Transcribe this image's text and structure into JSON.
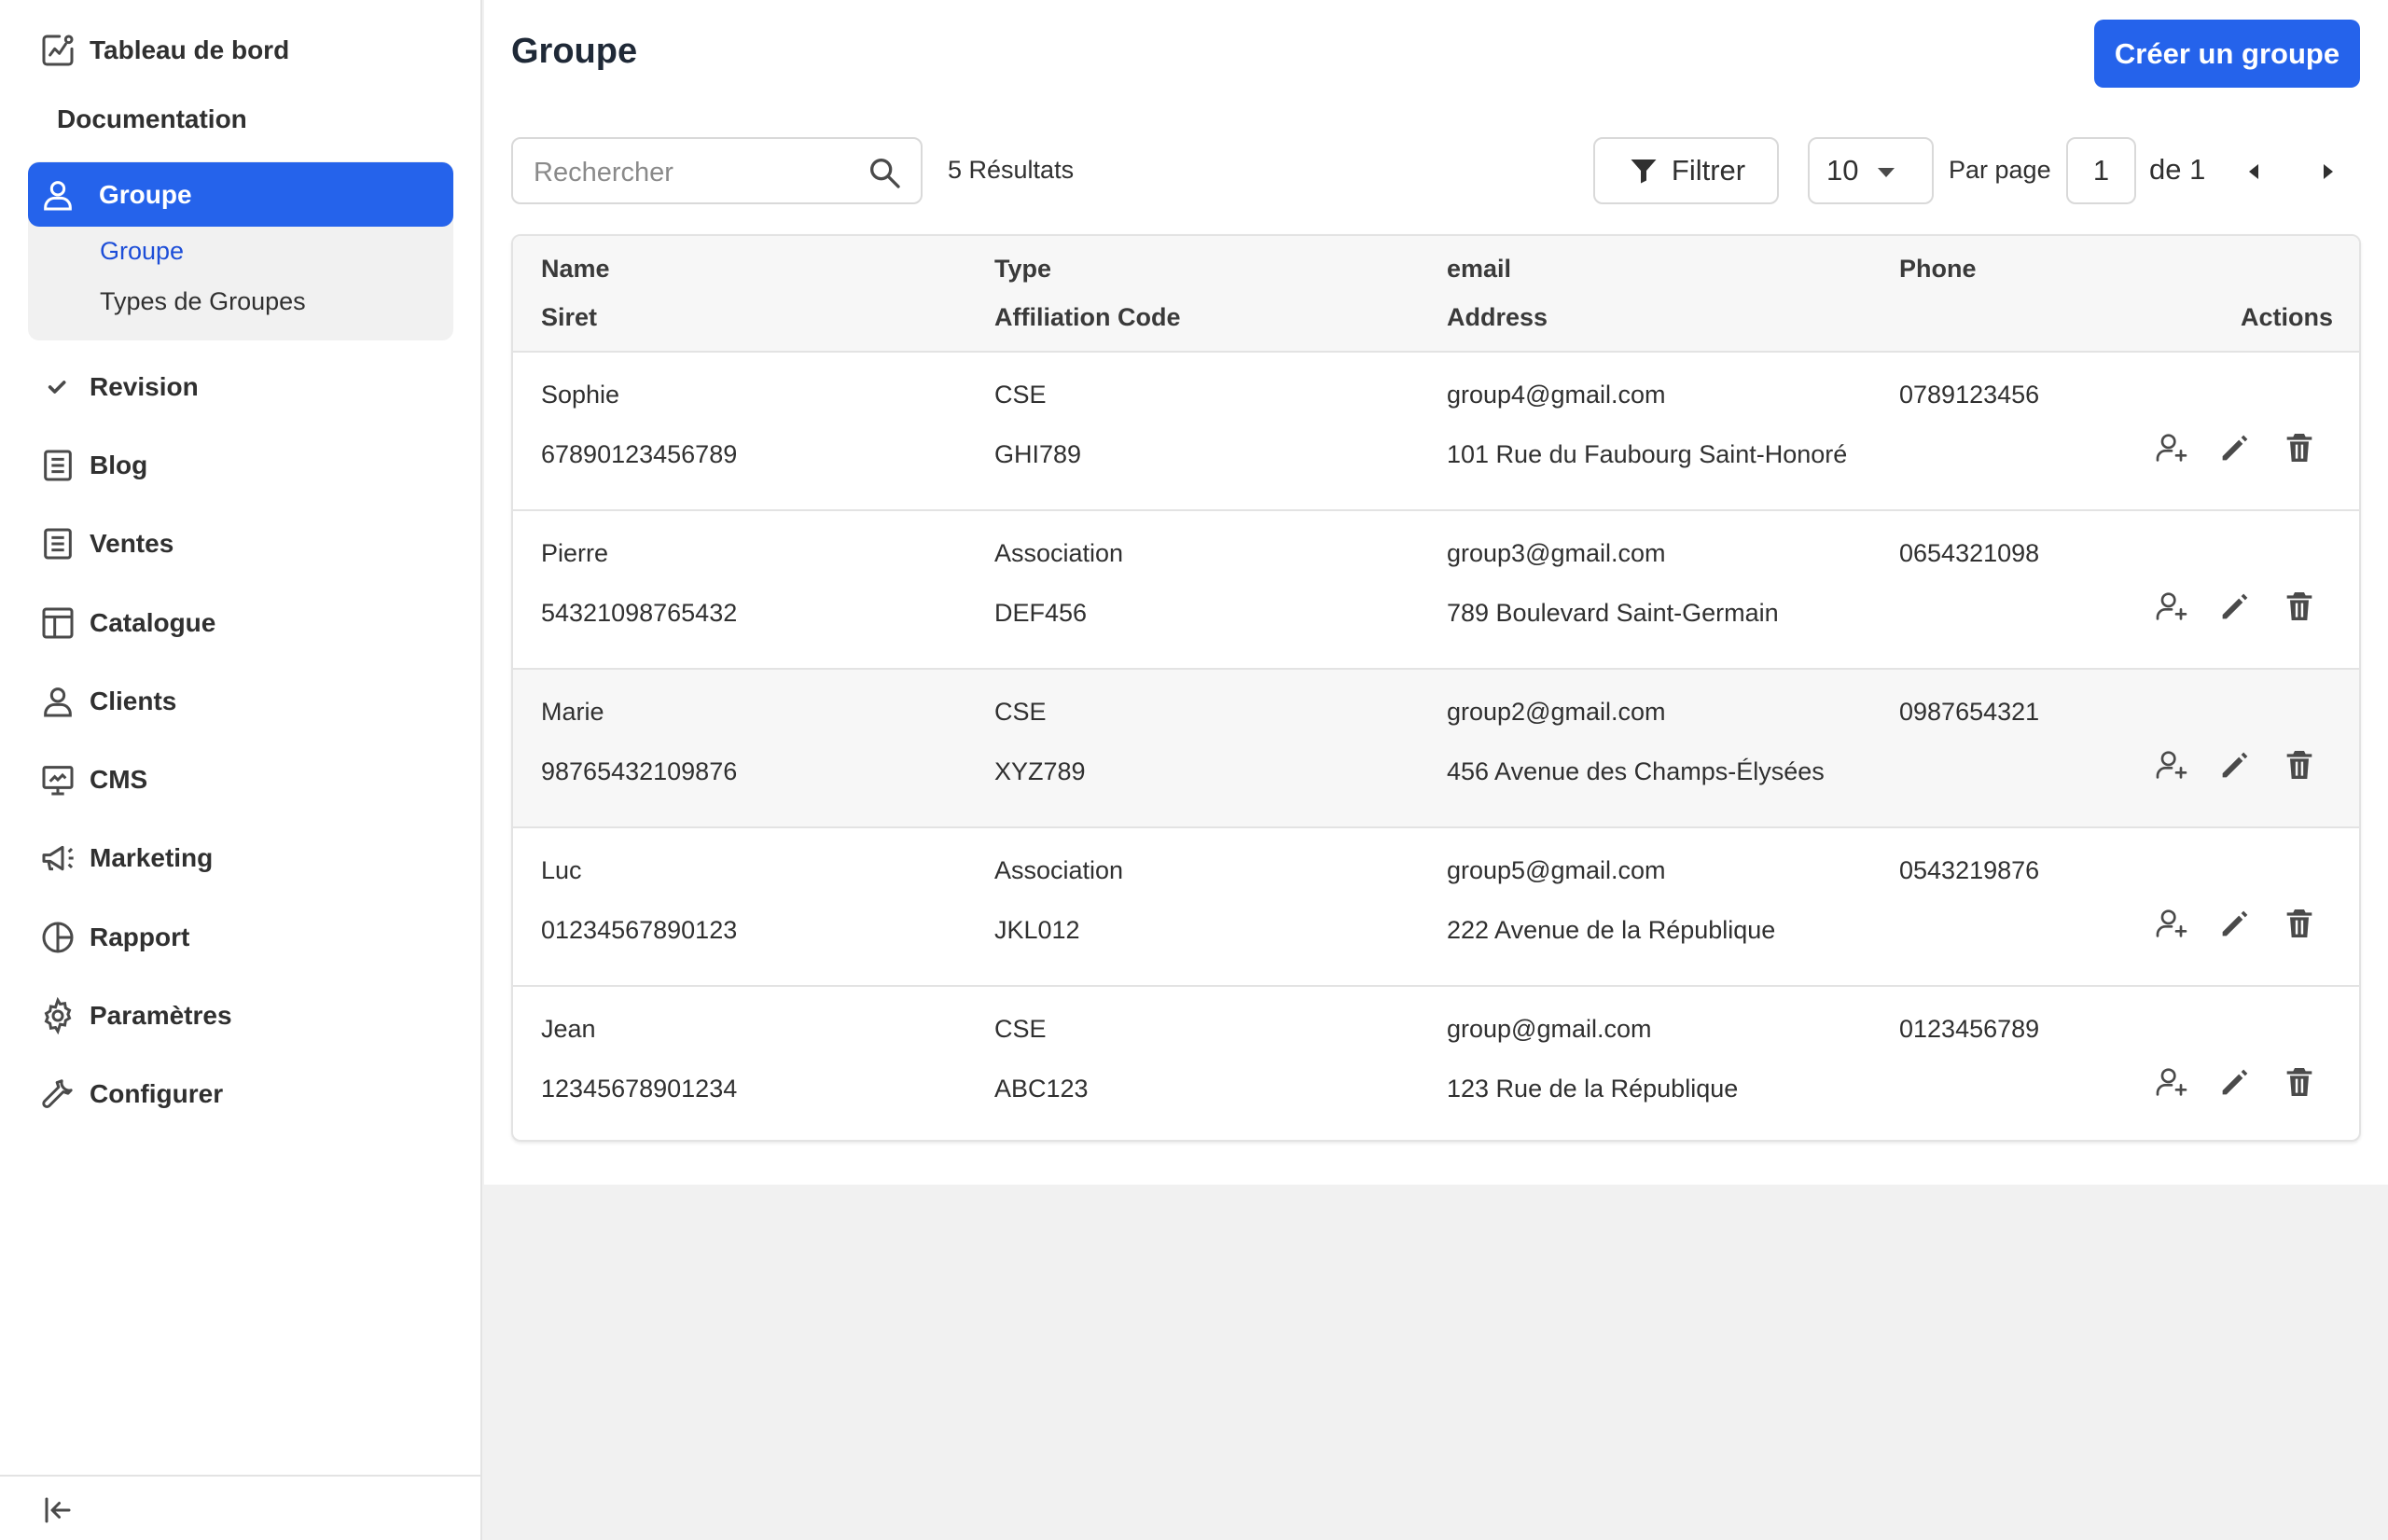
{
  "sidebar": {
    "dashboard": "Tableau de bord",
    "documentation": "Documentation",
    "active_section": "Groupe",
    "sub_items": [
      "Groupe",
      "Types de Groupes"
    ],
    "items": [
      {
        "label": "Revision",
        "icon": "check-icon"
      },
      {
        "label": "Blog",
        "icon": "document-icon"
      },
      {
        "label": "Ventes",
        "icon": "document-icon"
      },
      {
        "label": "Catalogue",
        "icon": "layout-icon"
      },
      {
        "label": "Clients",
        "icon": "user-icon"
      },
      {
        "label": "CMS",
        "icon": "monitor-icon"
      },
      {
        "label": "Marketing",
        "icon": "megaphone-icon"
      },
      {
        "label": "Rapport",
        "icon": "pie-chart-icon"
      },
      {
        "label": "Paramètres",
        "icon": "gear-icon"
      },
      {
        "label": "Configurer",
        "icon": "wrench-icon"
      }
    ]
  },
  "header": {
    "title": "Groupe",
    "create_button": "Créer un groupe"
  },
  "toolbar": {
    "search_placeholder": "Rechercher",
    "results": "5 Résultats",
    "filter_label": "Filtrer",
    "per_page_value": "10",
    "per_page_label": "Par page",
    "current_page": "1",
    "page_of": "de 1"
  },
  "table": {
    "headers": {
      "name": "Name",
      "type": "Type",
      "email": "email",
      "phone": "Phone",
      "siret": "Siret",
      "affiliation": "Affiliation Code",
      "address": "Address",
      "actions": "Actions"
    },
    "rows": [
      {
        "name": "Sophie",
        "type": "CSE",
        "email": "group4@gmail.com",
        "phone": "0789123456",
        "siret": "67890123456789",
        "affiliation": "GHI789",
        "address": "101 Rue du Faubourg Saint-Honoré"
      },
      {
        "name": "Pierre",
        "type": "Association",
        "email": "group3@gmail.com",
        "phone": "0654321098",
        "siret": "54321098765432",
        "affiliation": "DEF456",
        "address": "789 Boulevard Saint-Germain"
      },
      {
        "name": "Marie",
        "type": "CSE",
        "email": "group2@gmail.com",
        "phone": "0987654321",
        "siret": "98765432109876",
        "affiliation": "XYZ789",
        "address": "456 Avenue des Champs-Élysées"
      },
      {
        "name": "Luc",
        "type": "Association",
        "email": "group5@gmail.com",
        "phone": "0543219876",
        "siret": "01234567890123",
        "affiliation": "JKL012",
        "address": "222 Avenue de la République"
      },
      {
        "name": "Jean",
        "type": "CSE",
        "email": "group@gmail.com",
        "phone": "0123456789",
        "siret": "12345678901234",
        "affiliation": "ABC123",
        "address": "123 Rue de la République"
      }
    ]
  },
  "colors": {
    "accent": "#2563eb",
    "sub_active": "#1d4ed8",
    "text": "#303030",
    "border": "#e3e3e3"
  }
}
